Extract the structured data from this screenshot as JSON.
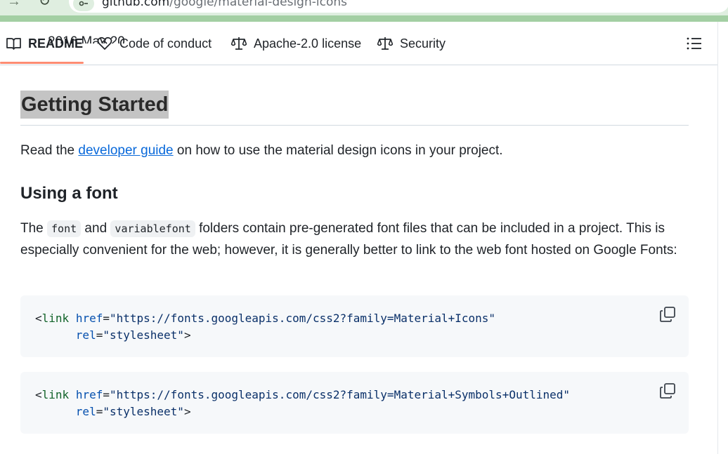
{
  "browser": {
    "url_host": "github.com",
    "url_path": "/google/material-design-icons"
  },
  "tabs": [
    {
      "label": "README",
      "icon": "book-icon",
      "active": true
    },
    {
      "label": "Code of conduct",
      "icon": "code-of-conduct-icon",
      "active": false
    },
    {
      "label": "Apache-2.0 license",
      "icon": "scale-icon",
      "active": false
    },
    {
      "label": "Security",
      "icon": "scale-icon",
      "active": false
    }
  ],
  "toc_icon": "list-icon",
  "scrolled_snippet": "2016 May 20",
  "readme": {
    "heading": "Getting Started",
    "intro_before": "Read the ",
    "intro_link": "developer guide",
    "intro_after": " on how to use the material design icons in your project.",
    "subheading": "Using a font",
    "p2_the": "The ",
    "p2_code1": "font",
    "p2_and": " and ",
    "p2_code2": "variablefont",
    "p2_rest": " folders contain pre-generated font files that can be included in a project. This is especially convenient for the web; however, it is generally better to link to the web font hosted on Google Fonts:",
    "code_blocks": [
      {
        "open": "<",
        "tag": "link",
        "attr1": "href",
        "val1": "\"https://fonts.googleapis.com/css2?family=Material+Icons\"",
        "attr2": "rel",
        "val2": "\"stylesheet\"",
        "close": ">"
      },
      {
        "open": "<",
        "tag": "link",
        "attr1": "href",
        "val1": "\"https://fonts.googleapis.com/css2?family=Material+Symbols+Outlined\"",
        "attr2": "rel",
        "val2": "\"stylesheet\"",
        "close": ">"
      }
    ],
    "copy_icon": "copy-icon"
  },
  "colors": {
    "link": "#0969da",
    "active_tab_underline": "#fd8c73",
    "browser_chrome": "#dfeee0"
  }
}
